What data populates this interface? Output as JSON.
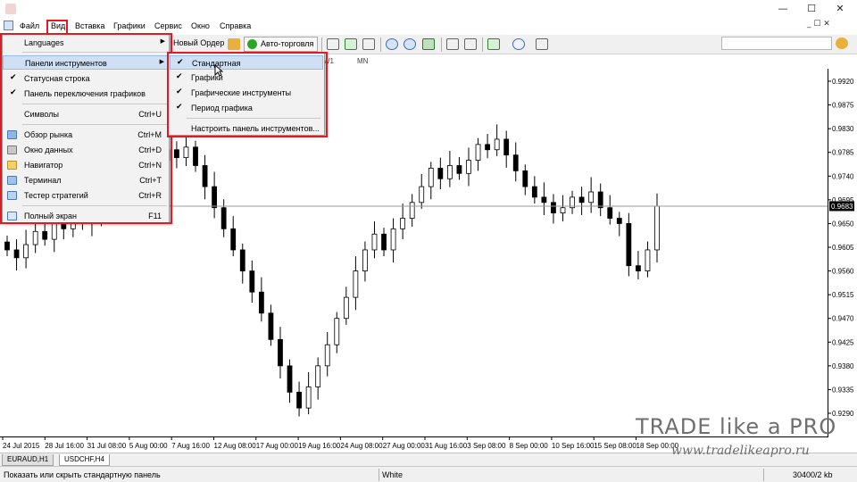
{
  "window": {
    "minimize": "—",
    "maximize": "☐",
    "close": "✕",
    "mdi": "_ ☐ ✕"
  },
  "menu": {
    "items": [
      "Файл",
      "Вид",
      "Вставка",
      "Графики",
      "Сервис",
      "Окно",
      "Справка"
    ]
  },
  "toolbar": {
    "new_order": "Новый Ордер",
    "auto_trading": "Авто-торговля"
  },
  "periods": [
    "W1",
    "MN"
  ],
  "view_menu": {
    "items": [
      {
        "label": "Languages",
        "has_submenu": true
      },
      {
        "label": "Панели инструментов",
        "has_submenu": true,
        "highlighted": true
      },
      {
        "label": "Статусная строка",
        "checked": true
      },
      {
        "label": "Панель переключения графиков",
        "checked": true
      },
      {
        "label": "Символы",
        "shortcut": "Ctrl+U"
      },
      {
        "label": "Обзор рынка",
        "shortcut": "Ctrl+M",
        "icon": "market-watch-icon"
      },
      {
        "label": "Окно данных",
        "shortcut": "Ctrl+D",
        "icon": "data-window-icon"
      },
      {
        "label": "Навигатор",
        "shortcut": "Ctrl+N",
        "icon": "navigator-icon"
      },
      {
        "label": "Терминал",
        "shortcut": "Ctrl+T",
        "icon": "terminal-icon"
      },
      {
        "label": "Тестер стратегий",
        "shortcut": "Ctrl+R",
        "icon": "tester-icon"
      },
      {
        "label": "Полный экран",
        "shortcut": "F11",
        "icon": "fullscreen-icon"
      }
    ]
  },
  "toolbars_submenu": {
    "items": [
      {
        "label": "Стандартная",
        "checked": true,
        "highlighted": true
      },
      {
        "label": "Графики",
        "checked": true
      },
      {
        "label": "Графические инструменты",
        "checked": true
      },
      {
        "label": "Период графика",
        "checked": true
      },
      {
        "label": "Настроить панель инструментов..."
      }
    ]
  },
  "chart_data": {
    "type": "candlestick",
    "symbol": "USDCHF,H4",
    "current_price": "0.9683",
    "price_axis": [
      "0.9920",
      "0.9875",
      "0.9830",
      "0.9785",
      "0.9740",
      "0.9695",
      "0.9650",
      "0.9605",
      "0.9560",
      "0.9515",
      "0.9470",
      "0.9425",
      "0.9380",
      "0.9335",
      "0.9290"
    ],
    "time_axis": [
      "24 Jul 2015",
      "28 Jul 16:00",
      "31 Jul 08:00",
      "5 Aug 00:00",
      "7 Aug 16:00",
      "12 Aug 08:00",
      "17 Aug 00:00",
      "19 Aug 16:00",
      "24 Aug 08:00",
      "27 Aug 00:00",
      "31 Aug 16:00",
      "3 Sep 08:00",
      "8 Sep 00:00",
      "10 Sep 16:00",
      "15 Sep 08:00",
      "18 Sep 00:00"
    ],
    "close_series": [
      0.96,
      0.9585,
      0.961,
      0.9635,
      0.962,
      0.9655,
      0.964,
      0.967,
      0.965,
      0.969,
      0.9665,
      0.97,
      0.972,
      0.9755,
      0.978,
      0.9745,
      0.977,
      0.979,
      0.9775,
      0.9795,
      0.976,
      0.972,
      0.968,
      0.964,
      0.96,
      0.956,
      0.952,
      0.948,
      0.943,
      0.938,
      0.933,
      0.93,
      0.934,
      0.938,
      0.942,
      0.947,
      0.951,
      0.956,
      0.96,
      0.963,
      0.96,
      0.964,
      0.966,
      0.969,
      0.972,
      0.9755,
      0.9735,
      0.976,
      0.9745,
      0.977,
      0.98,
      0.979,
      0.981,
      0.978,
      0.975,
      0.972,
      0.97,
      0.969,
      0.967,
      0.968,
      0.97,
      0.969,
      0.971,
      0.968,
      0.966,
      0.965,
      0.957,
      0.956,
      0.96,
      0.9683
    ]
  },
  "bottom_tabs": [
    "EURAUD,H1",
    "USDCHF,H4"
  ],
  "status": {
    "hint": "Показать или скрыть стандартную панель",
    "profile": "White",
    "traffic": "30400/2 kb"
  },
  "watermark": {
    "title": "TRADE like a PRO",
    "url": "www.tradelikeapro.ru"
  }
}
